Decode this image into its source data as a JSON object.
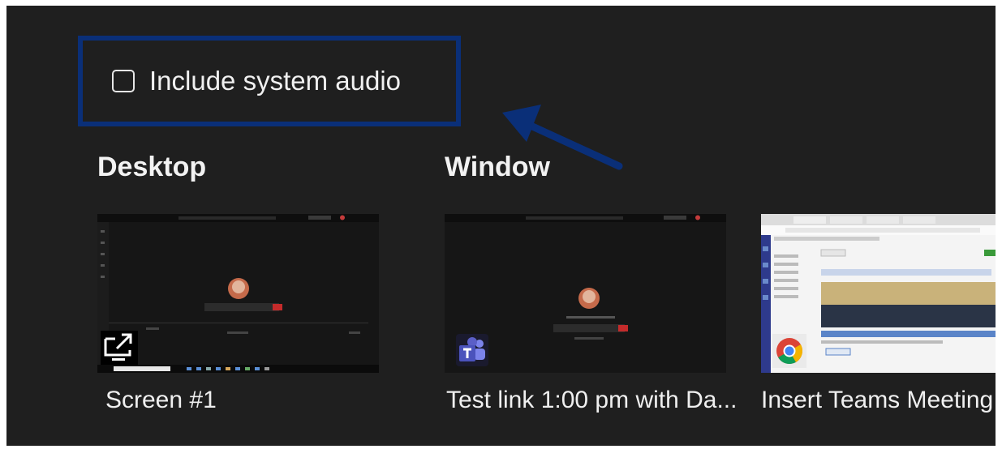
{
  "audio_option": {
    "label": "Include system audio",
    "checked": false
  },
  "sections": {
    "desktop_heading": "Desktop",
    "window_heading": "Window"
  },
  "sources": [
    {
      "name": "Screen #1",
      "icon": "screen-share-icon",
      "type": "desktop"
    },
    {
      "name": "Test link 1:00 pm with Da...",
      "icon": "teams-icon",
      "type": "window"
    },
    {
      "name": "Insert Teams Meeting L",
      "icon": "chrome-icon",
      "type": "window"
    }
  ],
  "colors": {
    "panel_bg": "#1f1f1f",
    "highlight": "#0a2f78",
    "arrow": "#0a2f78",
    "text": "#f0f0f0",
    "teams_purple": "#5b5fc7"
  }
}
